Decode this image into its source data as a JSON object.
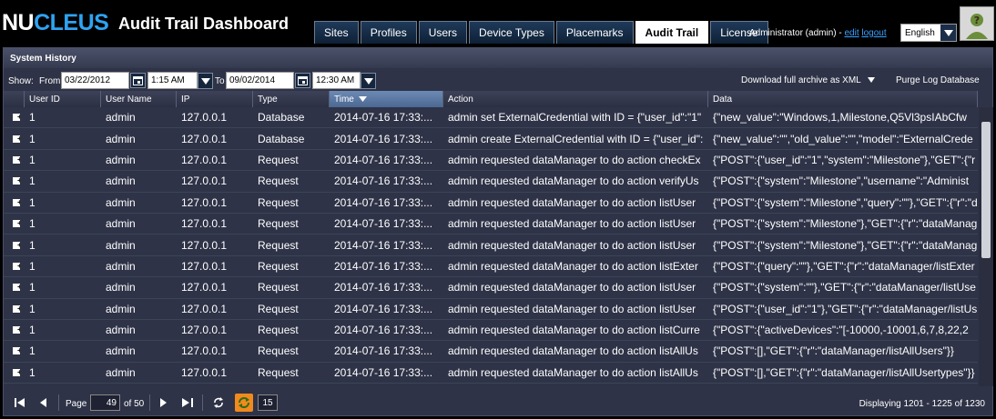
{
  "header": {
    "logo_a": "NU",
    "logo_b": "CLEUS",
    "app_title": "Audit Trail Dashboard",
    "tabs": [
      {
        "label": "Sites"
      },
      {
        "label": "Profiles"
      },
      {
        "label": "Users"
      },
      {
        "label": "Device Types"
      },
      {
        "label": "Placemarks"
      },
      {
        "label": "Audit Trail",
        "active": true
      },
      {
        "label": "License"
      }
    ],
    "user_text": "Administrator (admin) -",
    "edit_link": "edit",
    "logout_link": "logout",
    "language": "English",
    "avatar_icon": "user-question-icon"
  },
  "panel": {
    "title": "System History",
    "show_label": "Show:",
    "from_label": "From",
    "from_date": "03/22/2012",
    "from_time": "1:15 AM",
    "to_label": "To",
    "to_date": "09/02/2014",
    "to_time": "12:30 AM",
    "download_label": "Download full archive as XML",
    "purge_label": "Purge Log Database"
  },
  "grid": {
    "columns": [
      "",
      "User ID",
      "User Name",
      "IP",
      "Type",
      "Time",
      "Action",
      "Data"
    ],
    "sorted_column": "Time",
    "rows": [
      [
        "1",
        "admin",
        "127.0.0.1",
        "Database",
        "2014-07-16 17:33:...",
        "admin set ExternalCredential with ID = {\"user_id\":\"1\"",
        "{\"new_value\":\"Windows,1,Milestone,Q5Vl3psIAbCfw"
      ],
      [
        "1",
        "admin",
        "127.0.0.1",
        "Database",
        "2014-07-16 17:33:...",
        "admin create ExternalCredential with ID = {\"user_id\":",
        "{\"new_value\":\"\",\"old_value\":\"\",\"model\":\"ExternalCrede"
      ],
      [
        "1",
        "admin",
        "127.0.0.1",
        "Request",
        "2014-07-16 17:33:...",
        "admin requested dataManager to do action checkEx",
        "{\"POST\":{\"user_id\":\"1\",\"system\":\"Milestone\"},\"GET\":{\"r"
      ],
      [
        "1",
        "admin",
        "127.0.0.1",
        "Request",
        "2014-07-16 17:33:...",
        "admin requested dataManager to do action verifyUs",
        "{\"POST\":{\"system\":\"Milestone\",\"username\":\"Administ"
      ],
      [
        "1",
        "admin",
        "127.0.0.1",
        "Request",
        "2014-07-16 17:33:...",
        "admin requested dataManager to do action listUser",
        "{\"POST\":{\"system\":\"Milestone\",\"query\":\"\"},\"GET\":{\"r\":\"d"
      ],
      [
        "1",
        "admin",
        "127.0.0.1",
        "Request",
        "2014-07-16 17:33:...",
        "admin requested dataManager to do action listUser",
        "{\"POST\":{\"system\":\"Milestone\"},\"GET\":{\"r\":\"dataManag"
      ],
      [
        "1",
        "admin",
        "127.0.0.1",
        "Request",
        "2014-07-16 17:33:...",
        "admin requested dataManager to do action listUser",
        "{\"POST\":{\"system\":\"Milestone\"},\"GET\":{\"r\":\"dataManag"
      ],
      [
        "1",
        "admin",
        "127.0.0.1",
        "Request",
        "2014-07-16 17:33:...",
        "admin requested dataManager to do action listExter",
        "{\"POST\":{\"query\":\"\"},\"GET\":{\"r\":\"dataManager/listExter"
      ],
      [
        "1",
        "admin",
        "127.0.0.1",
        "Request",
        "2014-07-16 17:33:...",
        "admin requested dataManager to do action listUser",
        "{\"POST\":{\"system\":\"\"},\"GET\":{\"r\":\"dataManager/listUse"
      ],
      [
        "1",
        "admin",
        "127.0.0.1",
        "Request",
        "2014-07-16 17:33:...",
        "admin requested dataManager to do action listUser",
        "{\"POST\":{\"user_id\":\"1\"},\"GET\":{\"r\":\"dataManager/listUs"
      ],
      [
        "1",
        "admin",
        "127.0.0.1",
        "Request",
        "2014-07-16 17:33:...",
        "admin requested dataManager to do action listCurre",
        "{\"POST\":{\"activeDevices\":\"[-10000,-10001,6,7,8,22,2"
      ],
      [
        "1",
        "admin",
        "127.0.0.1",
        "Request",
        "2014-07-16 17:33:...",
        "admin requested dataManager to do action listAllUs",
        "{\"POST\":[],\"GET\":{\"r\":\"dataManager/listAllUsers\"}}"
      ],
      [
        "1",
        "admin",
        "127.0.0.1",
        "Request",
        "2014-07-16 17:33:...",
        "admin requested dataManager to do action listAllUs",
        "{\"POST\":[],\"GET\":{\"r\":\"dataManager/listAllUsertypes\"}}"
      ]
    ]
  },
  "pager": {
    "page_label": "Page",
    "page_value": "49",
    "of_label": "of 50",
    "page_size": "15",
    "display_text": "Displaying 1201 - 1225 of 1230"
  }
}
